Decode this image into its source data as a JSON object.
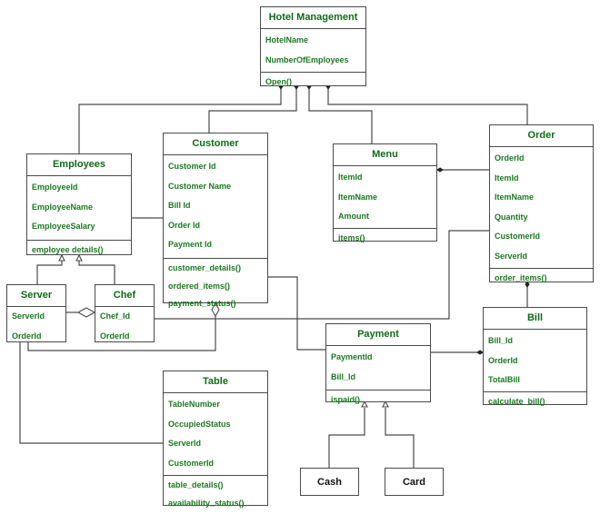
{
  "diagram": {
    "type": "UML class diagram",
    "colors": {
      "text": "#1a7a1e",
      "title": "#0f6b16",
      "line": "#4a4a4a"
    },
    "classes": {
      "hotel": {
        "name": "Hotel Management",
        "attributes": [
          "HotelName",
          "NumberOfEmployees"
        ],
        "methods": [
          "Open()"
        ]
      },
      "employees": {
        "name": "Employees",
        "attributes": [
          "EmployeeId",
          "EmployeeName",
          "EmployeeSalary"
        ],
        "methods": [
          "employee details()"
        ]
      },
      "customer": {
        "name": "Customer",
        "attributes": [
          "Customer Id",
          "Customer Name",
          "Bill Id",
          "Order Id",
          "Payment Id"
        ],
        "methods": [
          "customer_details()",
          "ordered_items()",
          "payment_status()"
        ]
      },
      "menu": {
        "name": "Menu",
        "attributes": [
          "ItemId",
          "ItemName",
          "Amount"
        ],
        "methods": [
          "items()"
        ]
      },
      "order": {
        "name": "Order",
        "attributes": [
          "OrderId",
          "ItemId",
          "ItemName",
          "Quantity",
          "CustomerId",
          "ServerId"
        ],
        "methods": [
          "order_items()"
        ]
      },
      "server": {
        "name": "Server",
        "attributes": [
          "ServerId",
          "OrderId"
        ],
        "methods": []
      },
      "chef": {
        "name": "Chef",
        "attributes": [
          "Chef_Id",
          "OrderId"
        ],
        "methods": []
      },
      "payment": {
        "name": "Payment",
        "attributes": [
          "PaymentId",
          "Bill_Id"
        ],
        "methods": [
          "ispaid()"
        ]
      },
      "bill": {
        "name": "Bill",
        "attributes": [
          "Bill_Id",
          "OrderId",
          "TotalBill"
        ],
        "methods": [
          "calculate_bill()"
        ]
      },
      "table": {
        "name": "Table",
        "attributes": [
          "TableNumber",
          "OccupiedStatus",
          "ServerId",
          "CustomerId"
        ],
        "methods": [
          "table_details()",
          "availability_status()"
        ]
      },
      "cash": {
        "name": "Cash"
      },
      "card": {
        "name": "Card"
      }
    },
    "relationships": [
      {
        "from": "Hotel Management",
        "to": "Employees",
        "kind": "composition"
      },
      {
        "from": "Hotel Management",
        "to": "Customer",
        "kind": "composition"
      },
      {
        "from": "Hotel Management",
        "to": "Menu",
        "kind": "composition"
      },
      {
        "from": "Hotel Management",
        "to": "Order",
        "kind": "composition"
      },
      {
        "from": "Order",
        "to": "Menu",
        "kind": "composition"
      },
      {
        "from": "Order",
        "to": "Bill",
        "kind": "composition"
      },
      {
        "from": "Bill",
        "to": "Payment",
        "kind": "composition"
      },
      {
        "from": "Server",
        "to": "Employees",
        "kind": "generalization"
      },
      {
        "from": "Chef",
        "to": "Employees",
        "kind": "generalization"
      },
      {
        "from": "Cash",
        "to": "Payment",
        "kind": "generalization"
      },
      {
        "from": "Card",
        "to": "Payment",
        "kind": "generalization"
      },
      {
        "from": "Chef",
        "to": "Server",
        "kind": "aggregation"
      },
      {
        "from": "Customer",
        "to": "Server",
        "kind": "aggregation"
      },
      {
        "from": "Employees",
        "to": "Customer",
        "kind": "association"
      },
      {
        "from": "Customer",
        "to": "Payment",
        "kind": "association"
      },
      {
        "from": "Chef",
        "to": "Order",
        "kind": "association"
      },
      {
        "from": "Server",
        "to": "Table",
        "kind": "association"
      }
    ]
  }
}
